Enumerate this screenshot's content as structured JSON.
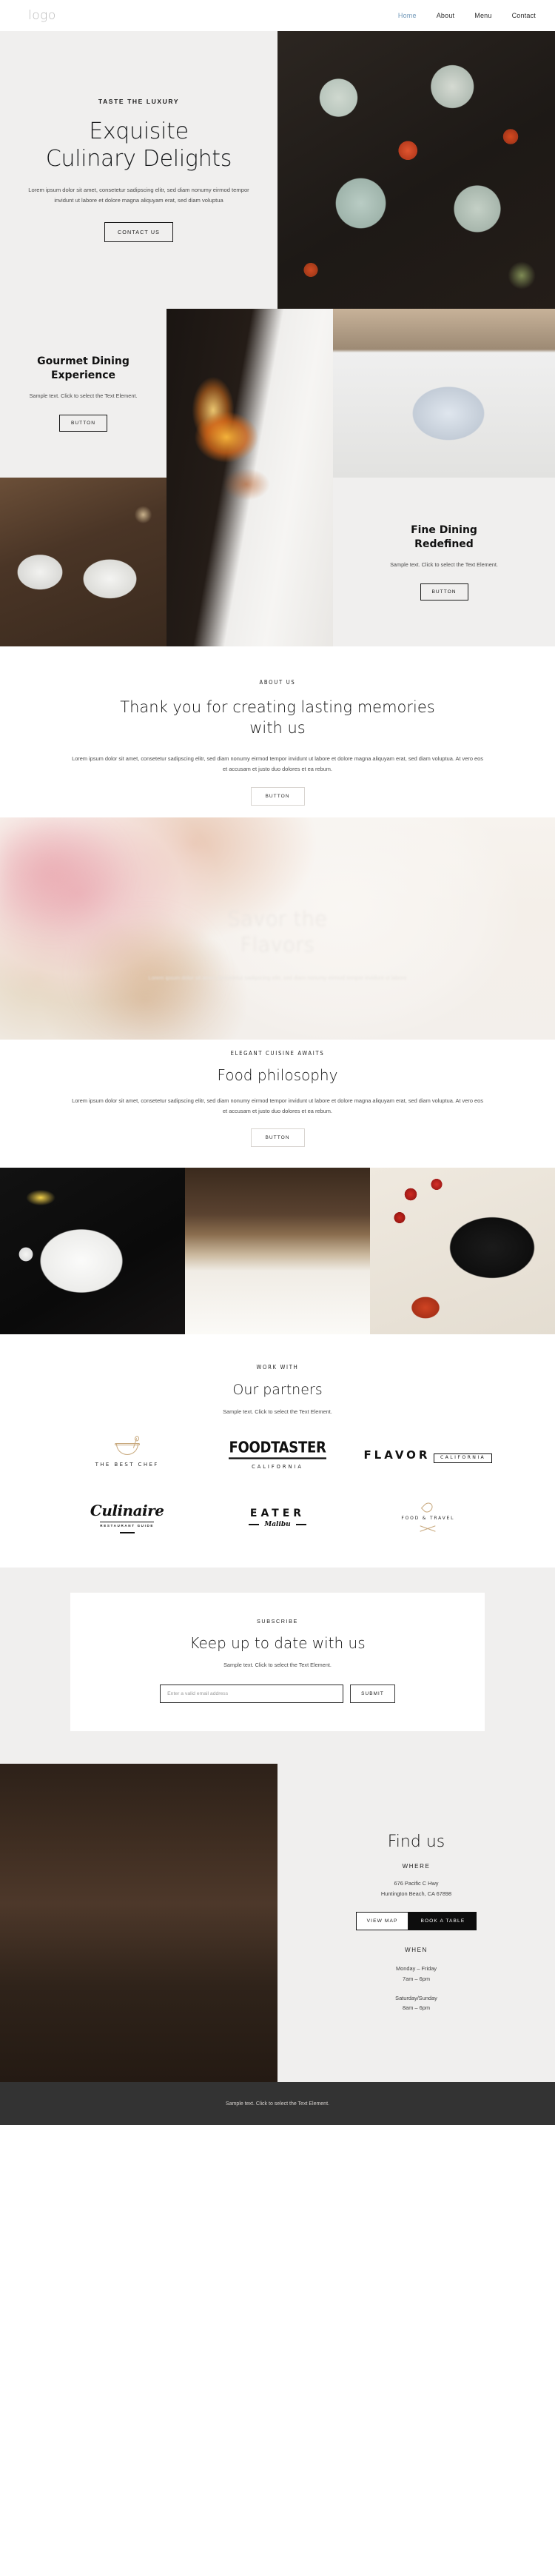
{
  "header": {
    "logo": "logo",
    "nav": [
      {
        "label": "Home",
        "active": true
      },
      {
        "label": "About",
        "active": false
      },
      {
        "label": "Menu",
        "active": false
      },
      {
        "label": "Contact",
        "active": false
      }
    ]
  },
  "hero": {
    "eyebrow": "TASTE THE LUXURY",
    "title_line1": "Exquisite",
    "title_line2": "Culinary Delights",
    "paragraph": "Lorem ipsum dolor sit amet, consetetur sadipscing elitr, sed diam nonumy eirmod tempor invidunt ut labore et dolore magna aliquyam erat, sed diam voluptua",
    "cta": "CONTACT US",
    "image_alt": "overhead-plated-dishes"
  },
  "features": {
    "gourmet": {
      "title_line1": "Gourmet Dining",
      "title_line2": "Experience",
      "text": "Sample text. Click to select the Text Element.",
      "button": "BUTTON"
    },
    "fine_dining": {
      "title_line1": "Fine Dining",
      "title_line2": "Redefined",
      "text": "Sample text. Click to select the Text Element.",
      "button": "BUTTON"
    },
    "images": {
      "chef_flame": "chef-flambe-pan",
      "plated_dessert": "plated-dessert-restaurant",
      "breakfast_table": "breakfast-table-overhead"
    }
  },
  "about": {
    "eyebrow": "ABOUT US",
    "title": "Thank you for creating lasting memories with us",
    "paragraph": "Lorem ipsum dolor sit amet, consetetur sadipscing elitr, sed diam nonumy eirmod tempor invidunt ut labore et dolore magna aliquyam erat, sed diam voluptua. At vero eos et accusam et justo duo dolores et ea rebum.",
    "button": "BUTTON",
    "ghost_heading_line1": "Savor the",
    "ghost_heading_line2": "Flavors",
    "ghost_text": "Lorem ipsum dolor sit amet, consetetur sadipscing elitr, sed diam nonumy eirmod tempor invidunt ut labore"
  },
  "philosophy": {
    "eyebrow": "ELEGANT CUISINE AWAITS",
    "title": "Food philosophy",
    "paragraph": "Lorem ipsum dolor sit amet, consetetur sadipscing elitr, sed diam nonumy eirmod tempor invidunt ut labore et dolore magna aliquyam erat, sed diam voluptua. At vero eos et accusam et justo duo dolores et ea rebum.",
    "button": "BUTTON"
  },
  "gallery": {
    "image1": "plated-salad-dark-overhead",
    "image2": "man-dining-restaurant",
    "image3": "tomatoes-and-pot-of-food"
  },
  "partners": {
    "eyebrow": "WORK WITH",
    "title": "Our partners",
    "subtitle": "Sample text. Click to select the Text Element.",
    "logos": [
      {
        "name": "the-best-chef",
        "text": "THE BEST CHEF",
        "sub": ""
      },
      {
        "name": "foodtaster",
        "text": "FOODTASTER",
        "sub": "CALIFORNIA"
      },
      {
        "name": "flavor",
        "text": "FLAVOR",
        "sub": "CALIFORNIA"
      },
      {
        "name": "culinaire",
        "text": "Culinaire",
        "sub": "RESTAURANT GUIDE"
      },
      {
        "name": "eater-malibu",
        "text": "EATER",
        "sub": "Malibu"
      },
      {
        "name": "food-and-travel",
        "text": "FOOD & TRAVEL",
        "sub": ""
      }
    ]
  },
  "subscribe": {
    "eyebrow": "SUBSCRIBE",
    "title": "Keep up to date with us",
    "text": "Sample text. Click to select the Text Element.",
    "input_placeholder": "Enter a valid email address",
    "input_value": "",
    "submit": "SUBMIT"
  },
  "findus": {
    "title": "Find us",
    "where_label": "WHERE",
    "address_line1": "676 Pacific C Hwy",
    "address_line2": "Huntington Beach, CA 67898",
    "view_map": "VIEW MAP",
    "book_table": "BOOK A TABLE",
    "when_label": "WHEN",
    "weekday_days": "Monday – Friday",
    "weekday_hours": "7am – 6pm",
    "weekend_days": "Saturday/Sunday",
    "weekend_hours": "8am – 6pm",
    "image_alt": "chef-in-restaurant-portrait"
  },
  "footer": {
    "text": "Sample text. Click to select the Text Element."
  },
  "colors": {
    "accent_nav": "#6f97b8",
    "panel_bg": "#f0efee",
    "footer_bg": "#333333",
    "text_dark": "#1a1a1a",
    "logo_gold": "#c8a97e"
  }
}
